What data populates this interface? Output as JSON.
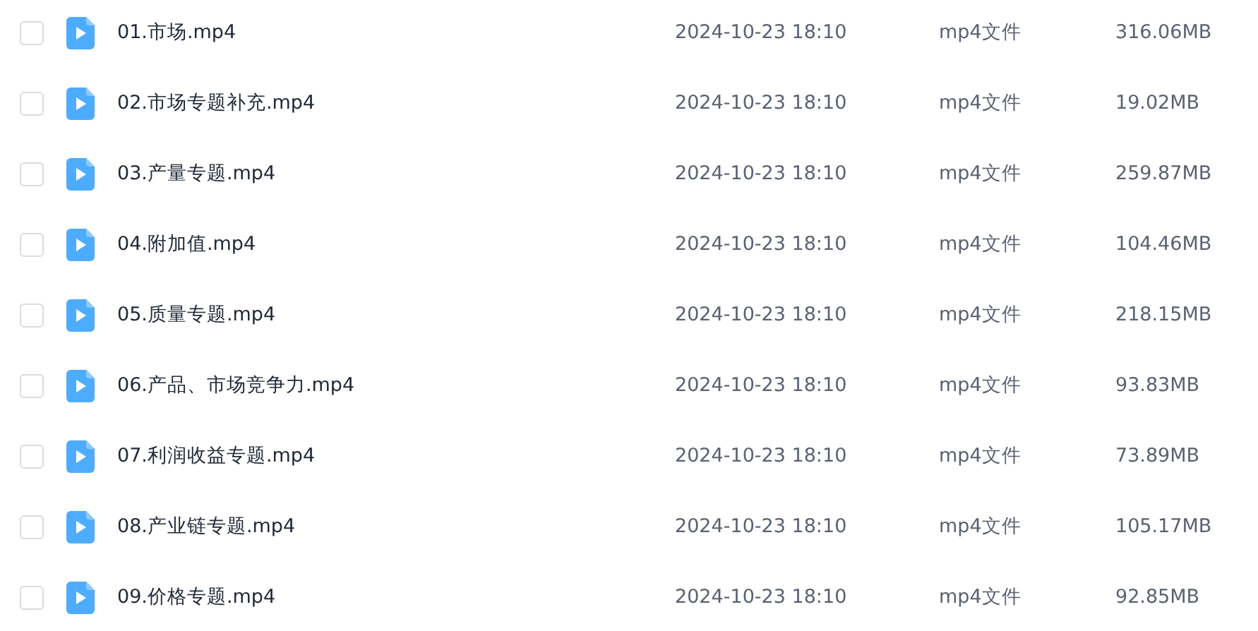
{
  "files": [
    {
      "name": "01.市场.mp4",
      "modified": "2024-10-23 18:10",
      "type": "mp4文件",
      "size": "316.06MB",
      "checked": false
    },
    {
      "name": "02.市场专题补充.mp4",
      "modified": "2024-10-23 18:10",
      "type": "mp4文件",
      "size": "19.02MB",
      "checked": false
    },
    {
      "name": "03.产量专题.mp4",
      "modified": "2024-10-23 18:10",
      "type": "mp4文件",
      "size": "259.87MB",
      "checked": false
    },
    {
      "name": "04.附加值.mp4",
      "modified": "2024-10-23 18:10",
      "type": "mp4文件",
      "size": "104.46MB",
      "checked": false
    },
    {
      "name": "05.质量专题.mp4",
      "modified": "2024-10-23 18:10",
      "type": "mp4文件",
      "size": "218.15MB",
      "checked": false
    },
    {
      "name": "06.产品、市场竞争力.mp4",
      "modified": "2024-10-23 18:10",
      "type": "mp4文件",
      "size": "93.83MB",
      "checked": false
    },
    {
      "name": "07.利润收益专题.mp4",
      "modified": "2024-10-23 18:10",
      "type": "mp4文件",
      "size": "73.89MB",
      "checked": false
    },
    {
      "name": "08.产业链专题.mp4",
      "modified": "2024-10-23 18:10",
      "type": "mp4文件",
      "size": "105.17MB",
      "checked": false
    },
    {
      "name": "09.价格专题.mp4",
      "modified": "2024-10-23 18:10",
      "type": "mp4文件",
      "size": "92.85MB",
      "checked": false
    }
  ]
}
